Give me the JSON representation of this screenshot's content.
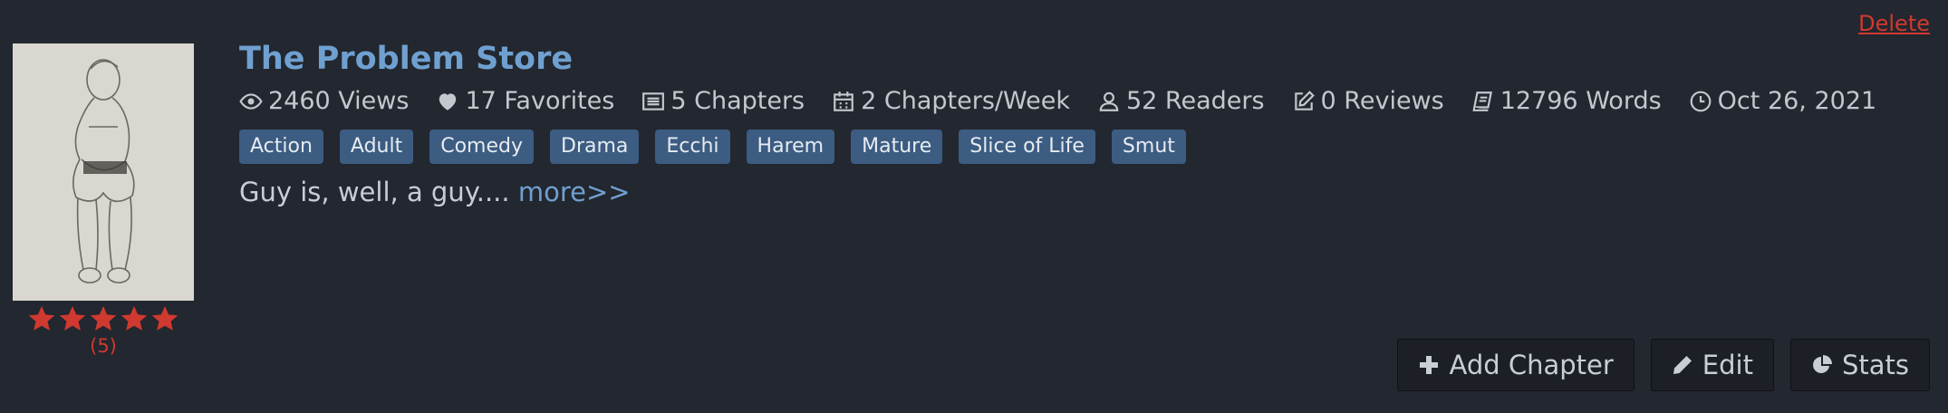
{
  "story": {
    "title": "The Problem Store",
    "delete_label": "Delete",
    "rating_count": "(5)",
    "rating_stars": 5,
    "stats": {
      "views": "2460 Views",
      "favorites": "17 Favorites",
      "chapters": "5 Chapters",
      "frequency": "2 Chapters/Week",
      "readers": "52 Readers",
      "reviews": "0 Reviews",
      "words": "12796 Words",
      "date": "Oct 26, 2021"
    },
    "tags": [
      "Action",
      "Adult",
      "Comedy",
      "Drama",
      "Ecchi",
      "Harem",
      "Mature",
      "Slice of Life",
      "Smut"
    ],
    "description": "Guy is, well, a guy....",
    "more_label": "more>>"
  },
  "actions": {
    "add_chapter": "Add Chapter",
    "edit": "Edit",
    "stats": "Stats"
  },
  "colors": {
    "background": "#23272f",
    "title": "#6fa0d0",
    "tag": "#3c5c82",
    "star": "#d0392f"
  }
}
